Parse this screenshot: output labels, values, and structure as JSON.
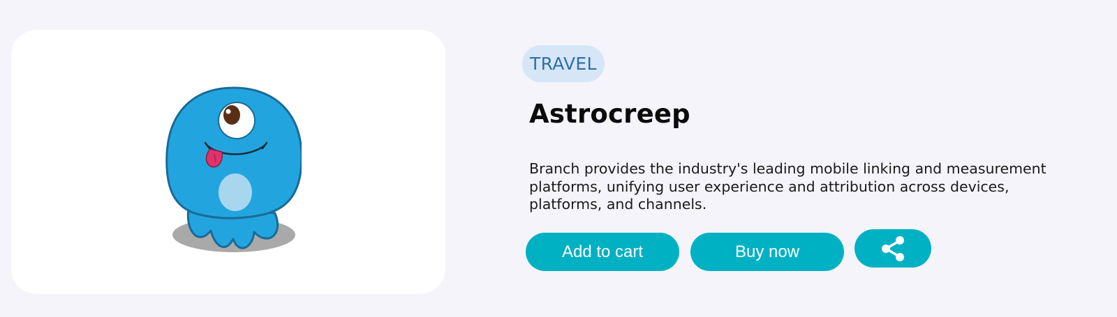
{
  "product": {
    "category": "TRAVEL",
    "title": "Astrocreep",
    "description": "Branch provides the industry's leading mobile linking and measurement platforms, unifying user experience and attribution across devices, platforms, and channels.",
    "image_icon": "one-eyed-octopus-mascot"
  },
  "actions": {
    "add_to_cart": "Add to cart",
    "buy_now": "Buy now",
    "share_icon": "share-icon"
  },
  "colors": {
    "background": "#f4f4fa",
    "card": "#ffffff",
    "accent": "#00b1c4",
    "badge_bg": "#d6e6f7",
    "badge_text": "#2f6fa6",
    "mascot_body": "#22a5de"
  }
}
